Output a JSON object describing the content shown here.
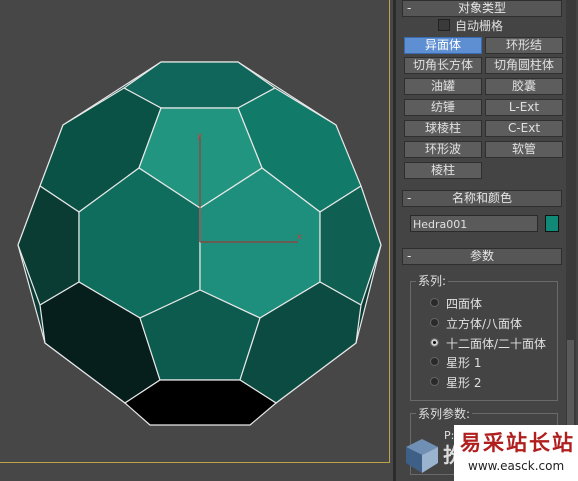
{
  "panel": {
    "object_type": {
      "title": "对象类型",
      "auto_grid_label": "自动栅格",
      "buttons": [
        "异面体",
        "环形结",
        "切角长方体",
        "切角圆柱体",
        "油罐",
        "胶囊",
        "纺锤",
        "L-Ext",
        "球棱柱",
        "C-Ext",
        "环形波",
        "软管",
        "棱柱"
      ],
      "selected": "异面体"
    },
    "name_color": {
      "title": "名称和颜色",
      "name_value": "Hedra001",
      "swatch_color": "#108a76"
    },
    "params": {
      "title": "参数",
      "family_label": "系列:",
      "family_options": [
        "四面体",
        "立方体/八面体",
        "十二面体/二十面体",
        "星形 1",
        "星形 2"
      ],
      "family_selected": "十二面体/二十面体",
      "family_params_label": "系列参数:",
      "p_label": "P:"
    }
  },
  "watermark": {
    "title": "易采站长站",
    "url": "www.easck.com",
    "side_text": "扮"
  },
  "viewport": {
    "axis_x": "x",
    "axis_y": "y"
  }
}
